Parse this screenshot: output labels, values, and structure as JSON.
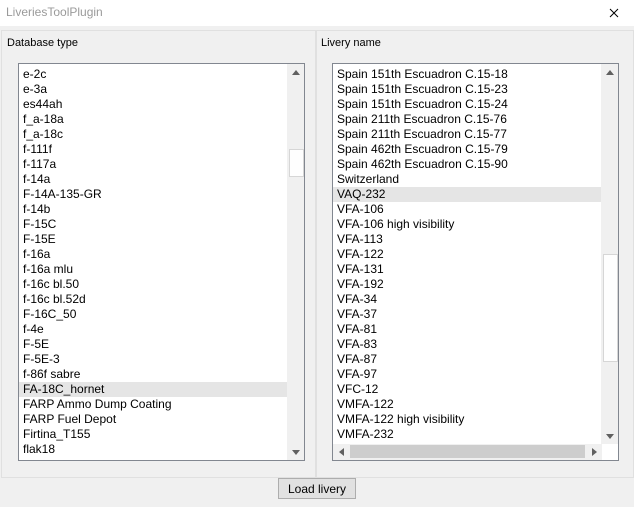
{
  "window": {
    "title": "LiveriesToolPlugin"
  },
  "left": {
    "label": "Database type",
    "items": [
      "e-2c",
      "e-3a",
      "es44ah",
      "f_a-18a",
      "f_a-18c",
      "f-111f",
      "f-117a",
      "f-14a",
      "F-14A-135-GR",
      "f-14b",
      "F-15C",
      "F-15E",
      "f-16a",
      "f-16a mlu",
      "f-16c bl.50",
      "f-16c bl.52d",
      "F-16C_50",
      "f-4e",
      "F-5E",
      "F-5E-3",
      "f-86f sabre",
      "FA-18C_hornet",
      "FARP Ammo Dump Coating",
      "FARP Fuel Depot",
      "Firtina_T155",
      "flak18"
    ],
    "highlighted_index": 21
  },
  "right": {
    "label": "Livery name",
    "items": [
      "Spain 151th Escuadron C.15-18",
      "Spain 151th Escuadron C.15-23",
      "Spain 151th Escuadron C.15-24",
      "Spain 211th Escuadron C.15-76",
      "Spain 211th Escuadron C.15-77",
      "Spain 462th Escuadron C.15-79",
      "Spain 462th Escuadron C.15-90",
      "Switzerland",
      "VAQ-232",
      "VFA-106",
      "VFA-106 high visibility",
      "VFA-113",
      "VFA-122",
      "VFA-131",
      "VFA-192",
      "VFA-34",
      "VFA-37",
      "VFA-81",
      "VFA-83",
      "VFA-87",
      "VFA-97",
      "VFC-12",
      "VMFA-122",
      "VMFA-122 high visibility",
      "VMFA-232"
    ],
    "highlighted_index": 8
  },
  "button": {
    "label": "Load livery"
  },
  "icons": {
    "close": "close-icon",
    "up": "scroll-up-arrow-icon",
    "down": "scroll-down-arrow-icon",
    "left": "scroll-left-arrow-icon",
    "right": "scroll-right-arrow-icon"
  }
}
